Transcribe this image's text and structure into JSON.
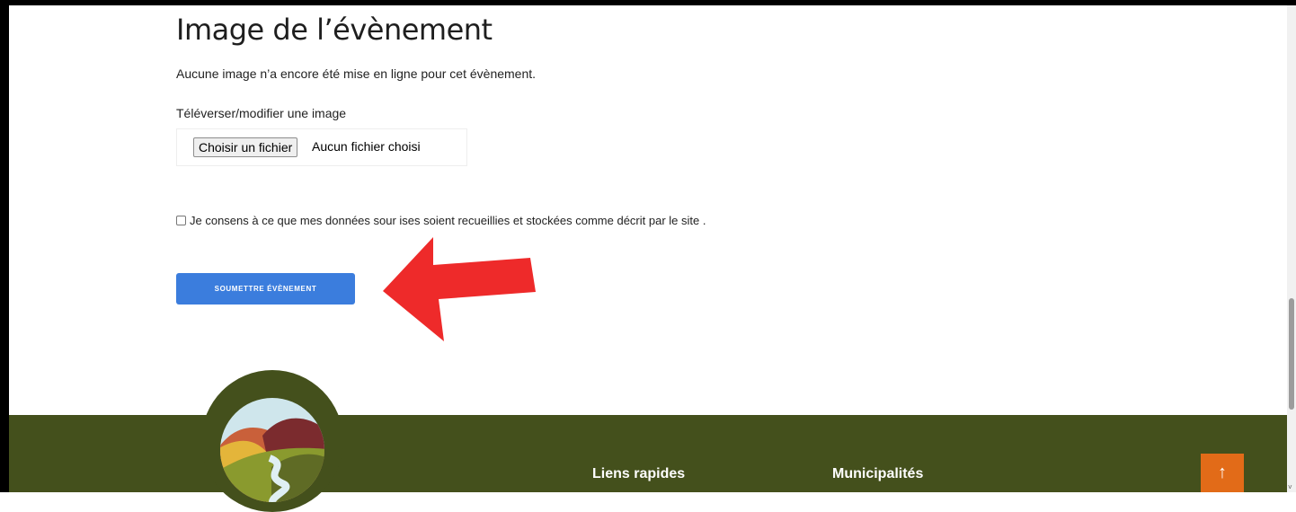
{
  "section": {
    "title": "Image de l’évènement",
    "info": "Aucune image n’a encore été mise en ligne pour cet évènement.",
    "upload_label": "Téléverser/modifier une image",
    "file_button": "Choisir un fichier",
    "file_status": "Aucun fichier choisi"
  },
  "consent": {
    "text": "Je consens à ce que mes données sour ises soient recueillies et stockées comme décrit par le site .",
    "checked": false
  },
  "submit": {
    "label": "SOUMETTRE ÉVÈNEMENT"
  },
  "footer": {
    "quick_links": "Liens rapides",
    "municipalities": "Municipalités",
    "to_top": "↑"
  },
  "colors": {
    "accent": "#3b7ddd",
    "footer_bg": "#44501c",
    "to_top_bg": "#e26b18",
    "annotation_arrow": "#ee2a2a"
  }
}
